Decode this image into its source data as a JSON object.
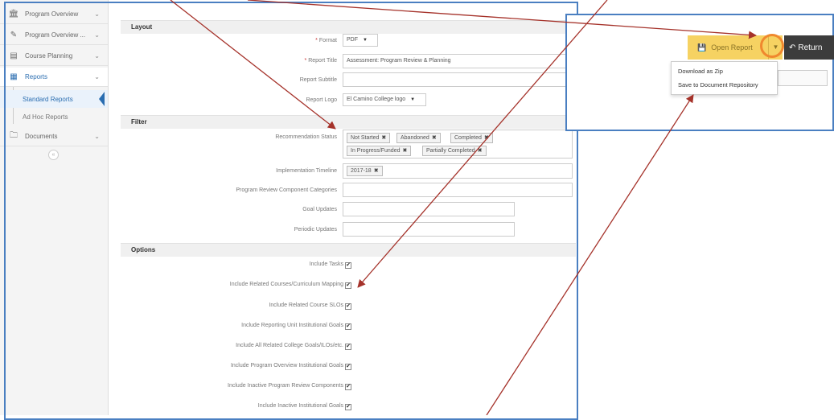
{
  "sidebar": {
    "items": [
      {
        "label": "Program Overview",
        "icon": "bank-icon"
      },
      {
        "label": "Program Overview ...",
        "icon": "pencil-icon"
      },
      {
        "label": "Course Planning",
        "icon": "book-icon"
      },
      {
        "label": "Reports",
        "icon": "table-icon"
      },
      {
        "label": "Documents",
        "icon": "folder-icon"
      }
    ],
    "subitems": [
      {
        "label": "Standard Reports"
      },
      {
        "label": "Ad Hoc Reports"
      }
    ],
    "collapse": "«"
  },
  "layout": {
    "header": "Layout",
    "format": {
      "label": "Format",
      "value": "PDF"
    },
    "report_title": {
      "label": "Report Title",
      "value": "Assessment: Program Review & Planning"
    },
    "report_subtitle": {
      "label": "Report Subtitle",
      "value": ""
    },
    "report_logo": {
      "label": "Report Logo",
      "value": "El Camino College logo"
    }
  },
  "filter": {
    "header": "Filter",
    "recommendation_status": {
      "label": "Recommendation Status",
      "tags": [
        "Not Started",
        "Abandoned",
        "Completed",
        "In Progress/Funded",
        "Partially Completed"
      ]
    },
    "implementation_timeline": {
      "label": "Implementation Timeline",
      "tags": [
        "2017-18"
      ]
    },
    "component_categories": {
      "label": "Program Review Component Categories",
      "value": ""
    },
    "goal_updates": {
      "label": "Goal Updates",
      "value": ""
    },
    "periodic_updates": {
      "label": "Periodic Updates",
      "value": ""
    }
  },
  "options": {
    "header": "Options",
    "checks": [
      {
        "label": "Include Tasks",
        "checked": true
      },
      {
        "label": "Include Related Courses/Curriculum Mapping",
        "checked": true
      },
      {
        "label": "Include Related Course SLOs",
        "checked": true
      },
      {
        "label": "Include Reporting Unit Institutional Goals",
        "checked": true
      },
      {
        "label": "Include All Related College Goals/ILOs/etc.",
        "checked": true
      },
      {
        "label": "Include Program Overview Institutional Goals",
        "checked": true
      },
      {
        "label": "Include Inactive Program Review Components",
        "checked": true
      },
      {
        "label": "Include Inactive Institutional Goals",
        "checked": true
      }
    ]
  },
  "actions": {
    "open_report": "Open Report",
    "return": "Return",
    "menu": [
      "Download as Zip",
      "Save to Document Repository"
    ]
  },
  "colors": {
    "accent": "#2a6db0",
    "button_yellow": "#f6d262",
    "annotation_arrow": "#a5322a",
    "highlight_ring": "#f0882e",
    "frame_blue": "#4a7fc1"
  }
}
